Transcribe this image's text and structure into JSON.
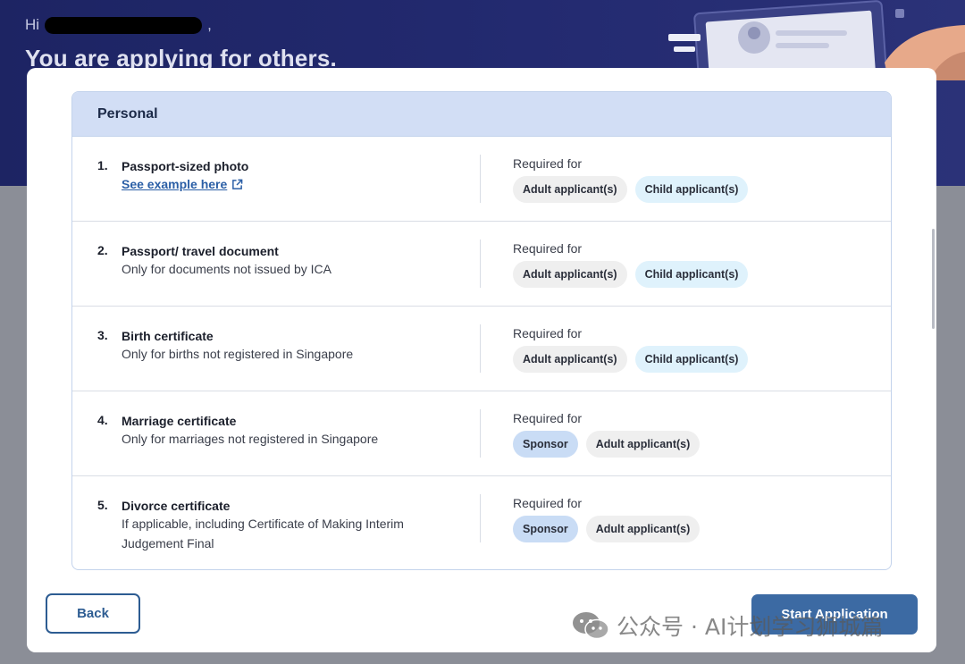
{
  "hero": {
    "greeting": "Hi",
    "greeting_suffix": ",",
    "heading": "You are applying for others."
  },
  "card": {
    "title": "Personal",
    "required_for_label": "Required for",
    "documents": [
      {
        "number": "1.",
        "title": "Passport-sized photo",
        "link": "See example here",
        "desc": [],
        "pills": [
          {
            "label": "Adult applicant(s)",
            "kind": "adult"
          },
          {
            "label": "Child applicant(s)",
            "kind": "child"
          }
        ]
      },
      {
        "number": "2.",
        "title": "Passport/ travel document",
        "desc": [
          "Only for documents not issued by ICA"
        ],
        "pills": [
          {
            "label": "Adult applicant(s)",
            "kind": "adult"
          },
          {
            "label": "Child applicant(s)",
            "kind": "child"
          }
        ]
      },
      {
        "number": "3.",
        "title": "Birth certificate",
        "desc": [
          "Only for births not registered in Singapore"
        ],
        "pills": [
          {
            "label": "Adult applicant(s)",
            "kind": "adult"
          },
          {
            "label": "Child applicant(s)",
            "kind": "child"
          }
        ]
      },
      {
        "number": "4.",
        "title": "Marriage certificate",
        "desc": [
          "Only for marriages not registered in Singapore"
        ],
        "pills": [
          {
            "label": "Sponsor",
            "kind": "sponsor"
          },
          {
            "label": "Adult applicant(s)",
            "kind": "adult"
          }
        ]
      },
      {
        "number": "5.",
        "title": "Divorce certificate",
        "desc": [
          "If applicable, including Certificate of Making Interim",
          "Judgement Final"
        ],
        "pills": [
          {
            "label": "Sponsor",
            "kind": "sponsor"
          },
          {
            "label": "Adult applicant(s)",
            "kind": "adult"
          }
        ]
      }
    ]
  },
  "footer": {
    "back_label": "Back",
    "start_label": "Start Application"
  },
  "watermark": {
    "text": "公众号 · AI计划学习狮城篇"
  },
  "colors": {
    "hero_bg": "#1d2463",
    "card_header_bg": "#d2def5",
    "primary": "#3c6aa3",
    "link": "#2b5fa6",
    "pill_adult": "#efefef",
    "pill_child": "#dff2fc",
    "pill_sponsor": "#c9dcf5"
  }
}
